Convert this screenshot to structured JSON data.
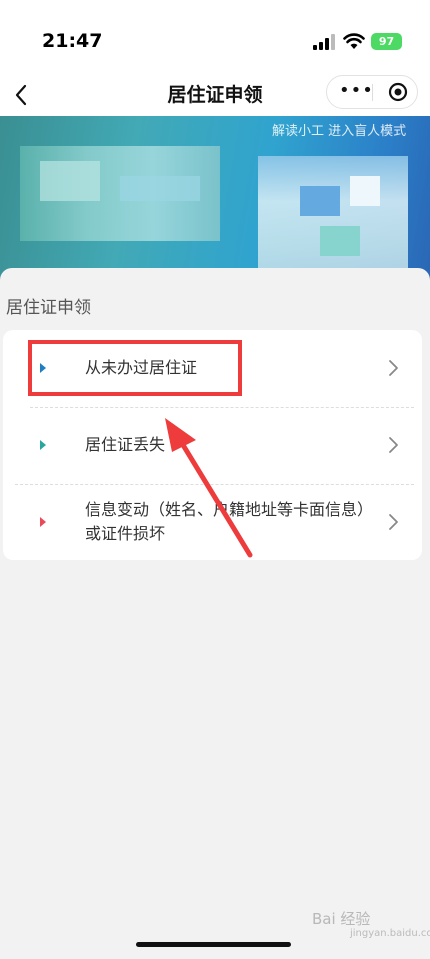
{
  "status_bar": {
    "time": "21:47",
    "battery": "97"
  },
  "nav": {
    "title": "居住证申领",
    "more_icon": "more-icon",
    "target_icon": "target-icon"
  },
  "banner": {
    "text": "解读小工 进入盲人模式"
  },
  "section": {
    "title": "居住证申领"
  },
  "items": [
    {
      "label": "从未办过居住证",
      "marker_color": "#1f7fc2"
    },
    {
      "label": "居住证丢失",
      "marker_color": "#2aa6a0"
    },
    {
      "label": "信息变动（姓名、户籍地址等卡面信息）或证件损坏",
      "marker_color": "#e94b5a"
    }
  ],
  "annotation": {
    "highlight_color": "#ee3b3b"
  },
  "watermark": {
    "text": "Bai 经验",
    "sub": "jingyan.baidu.com"
  }
}
